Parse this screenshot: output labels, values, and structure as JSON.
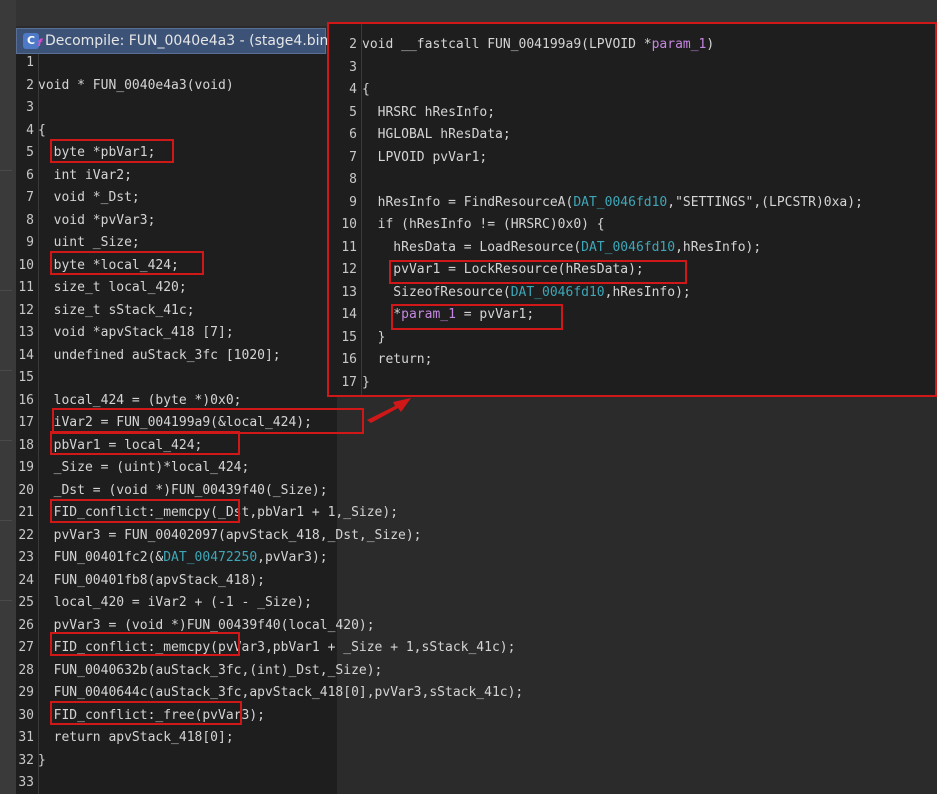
{
  "window": {
    "title": "Decompile: FUN_0040e4a3 -  (stage4.bin)",
    "icon_name": "decompile-icon"
  },
  "left_code": {
    "lines": [
      {
        "n": "1",
        "t": ""
      },
      {
        "n": "2",
        "t": "void * FUN_0040e4a3(void)"
      },
      {
        "n": "3",
        "t": ""
      },
      {
        "n": "4",
        "t": "{"
      },
      {
        "n": "5",
        "t": "  byte *pbVar1;"
      },
      {
        "n": "6",
        "t": "  int iVar2;"
      },
      {
        "n": "7",
        "t": "  void *_Dst;"
      },
      {
        "n": "8",
        "t": "  void *pvVar3;"
      },
      {
        "n": "9",
        "t": "  uint _Size;"
      },
      {
        "n": "10",
        "t": "  byte *local_424;"
      },
      {
        "n": "11",
        "t": "  size_t local_420;"
      },
      {
        "n": "12",
        "t": "  size_t sStack_41c;"
      },
      {
        "n": "13",
        "t": "  void *apvStack_418 [7];"
      },
      {
        "n": "14",
        "t": "  undefined auStack_3fc [1020];"
      },
      {
        "n": "15",
        "t": ""
      },
      {
        "n": "16",
        "t": "  local_424 = (byte *)0x0;"
      },
      {
        "n": "17",
        "t": "  iVar2 = FUN_004199a9(&local_424);"
      },
      {
        "n": "18",
        "t": "  pbVar1 = local_424;"
      },
      {
        "n": "19",
        "t": "  _Size = (uint)*local_424;"
      },
      {
        "n": "20",
        "t": "  _Dst = (void *)FUN_00439f40(_Size);"
      },
      {
        "n": "21",
        "t": "  FID_conflict:_memcpy(_Dst,pbVar1 + 1,_Size);"
      },
      {
        "n": "22",
        "t": "  pvVar3 = FUN_00402097(apvStack_418,_Dst,_Size);"
      },
      {
        "n": "23",
        "t": "  FUN_00401fc2(&DAT_00472250,pvVar3);"
      },
      {
        "n": "24",
        "t": "  FUN_00401fb8(apvStack_418);"
      },
      {
        "n": "25",
        "t": "  local_420 = iVar2 + (-1 - _Size);"
      },
      {
        "n": "26",
        "t": "  pvVar3 = (void *)FUN_00439f40(local_420);"
      },
      {
        "n": "27",
        "t": "  FID_conflict:_memcpy(pvVar3,pbVar1 + _Size + 1,sStack_41c);"
      },
      {
        "n": "28",
        "t": "  FUN_0040632b(auStack_3fc,(int)_Dst,_Size);"
      },
      {
        "n": "29",
        "t": "  FUN_0040644c(auStack_3fc,apvStack_418[0],pvVar3,sStack_41c);"
      },
      {
        "n": "30",
        "t": "  FID_conflict:_free(pvVar3);"
      },
      {
        "n": "31",
        "t": "  return apvStack_418[0];"
      },
      {
        "n": "32",
        "t": "}"
      },
      {
        "n": "33",
        "t": ""
      }
    ]
  },
  "right_code": {
    "lines": [
      {
        "n": "2",
        "t": "void __fastcall FUN_004199a9(LPVOID *param_1)"
      },
      {
        "n": "3",
        "t": ""
      },
      {
        "n": "4",
        "t": "{"
      },
      {
        "n": "5",
        "t": "  HRSRC hResInfo;"
      },
      {
        "n": "6",
        "t": "  HGLOBAL hResData;"
      },
      {
        "n": "7",
        "t": "  LPVOID pvVar1;"
      },
      {
        "n": "8",
        "t": ""
      },
      {
        "n": "9",
        "t": "  hResInfo = FindResourceA(DAT_0046fd10,\"SETTINGS\",(LPCSTR)0xa);"
      },
      {
        "n": "10",
        "t": "  if (hResInfo != (HRSRC)0x0) {"
      },
      {
        "n": "11",
        "t": "    hResData = LoadResource(DAT_0046fd10,hResInfo);"
      },
      {
        "n": "12",
        "t": "    pvVar1 = LockResource(hResData);"
      },
      {
        "n": "13",
        "t": "    SizeofResource(DAT_0046fd10,hResInfo);"
      },
      {
        "n": "14",
        "t": "    *param_1 = pvVar1;"
      },
      {
        "n": "15",
        "t": "  }"
      },
      {
        "n": "16",
        "t": "  return;"
      },
      {
        "n": "17",
        "t": "}"
      }
    ]
  },
  "colors": {
    "highlight_box": "#d01818",
    "background": "#1e1e1e",
    "data_ref": "#3ea6b7",
    "param": "#c586e0"
  }
}
